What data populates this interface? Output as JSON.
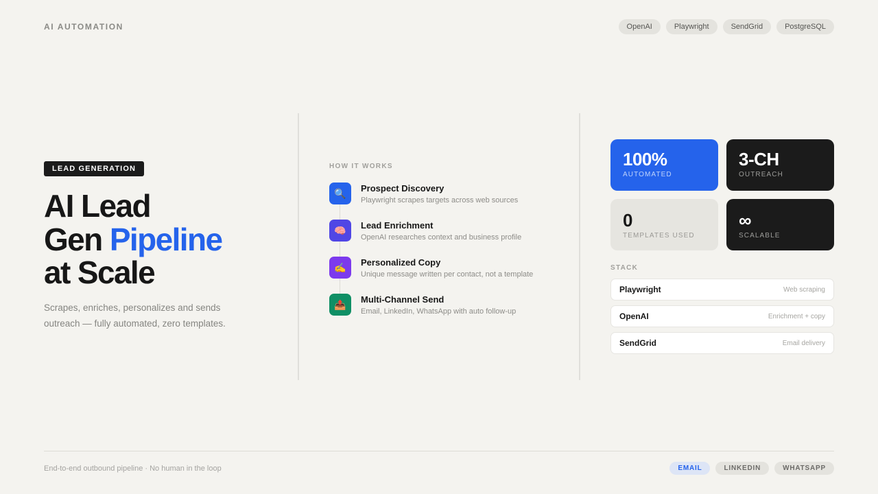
{
  "header": {
    "brand": "AI AUTOMATION",
    "tech_pills": [
      "OpenAI",
      "Playwright",
      "SendGrid",
      "PostgreSQL"
    ]
  },
  "hero": {
    "badge": "LEAD GENERATION",
    "headline_line1": "AI Lead",
    "headline_line2_pre": "Gen ",
    "headline_line2_accent": "Pipeline",
    "headline_line3": "at Scale",
    "subtext": "Scrapes, enriches, personalizes and sends outreach — fully automated, zero templates."
  },
  "how_it_works": {
    "label": "HOW IT WORKS",
    "steps": [
      {
        "title": "Prospect Discovery",
        "desc": "Playwright scrapes targets across web sources",
        "icon": "magnifier-icon",
        "color": "#2563eb"
      },
      {
        "title": "Lead Enrichment",
        "desc": "OpenAI researches context and business profile",
        "icon": "brain-icon",
        "color": "#5046e5"
      },
      {
        "title": "Personalized Copy",
        "desc": "Unique message written per contact, not a template",
        "icon": "writing-hand-icon",
        "color": "#7c3aed"
      },
      {
        "title": "Multi-Channel Send",
        "desc": "Email, LinkedIn, WhatsApp with auto follow-up",
        "icon": "outbox-tray-icon",
        "color": "#0f8f65"
      }
    ]
  },
  "stats": [
    {
      "value": "100%",
      "label": "AUTOMATED",
      "color": "#2563eb"
    },
    {
      "value": "3-CH",
      "label": "OUTREACH",
      "color": "#1b1b1b"
    },
    {
      "value": "0",
      "label": "TEMPLATES USED",
      "color": "#e6e5e0"
    },
    {
      "value": "∞",
      "label": "SCALABLE",
      "color": "#1b1b1b"
    }
  ],
  "stack": {
    "label": "STACK",
    "items": [
      {
        "name": "Playwright",
        "desc": "Web scraping"
      },
      {
        "name": "OpenAI",
        "desc": "Enrichment + copy"
      },
      {
        "name": "SendGrid",
        "desc": "Email delivery"
      }
    ]
  },
  "footer": {
    "text": "End-to-end outbound pipeline · No human in the loop",
    "channels": [
      {
        "label": "EMAIL",
        "active": true
      },
      {
        "label": "LINKEDIN",
        "active": false
      },
      {
        "label": "WHATSAPP",
        "active": false
      }
    ]
  },
  "colors": {
    "accent": "#2563eb",
    "background": "#f4f3ef",
    "dark": "#1b1b1b"
  }
}
